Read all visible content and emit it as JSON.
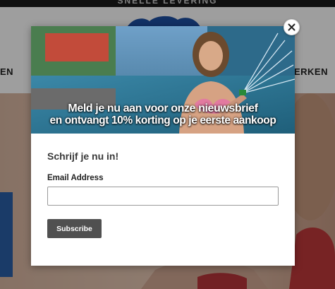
{
  "announcement": {
    "text": "SNELLE LEVERING"
  },
  "header": {
    "logo_alt": "Skiibad",
    "nav_left_partial": "EN",
    "nav_right_partial": "ERKEN"
  },
  "popup": {
    "banner_line1": "Meld je nu aan voor onze nieuwsbrief",
    "banner_line2": "en ontvangt 10% korting op je eerste aankoop",
    "heading": "Schrijf je nu in!",
    "email_label": "Email Address",
    "email_value": "",
    "email_placeholder": "",
    "subscribe_label": "Subscribe",
    "close_icon": "close-icon"
  },
  "colors": {
    "overlay": "#00000061",
    "button_bg": "#505050",
    "logo_blue": "#1e4fa3"
  }
}
